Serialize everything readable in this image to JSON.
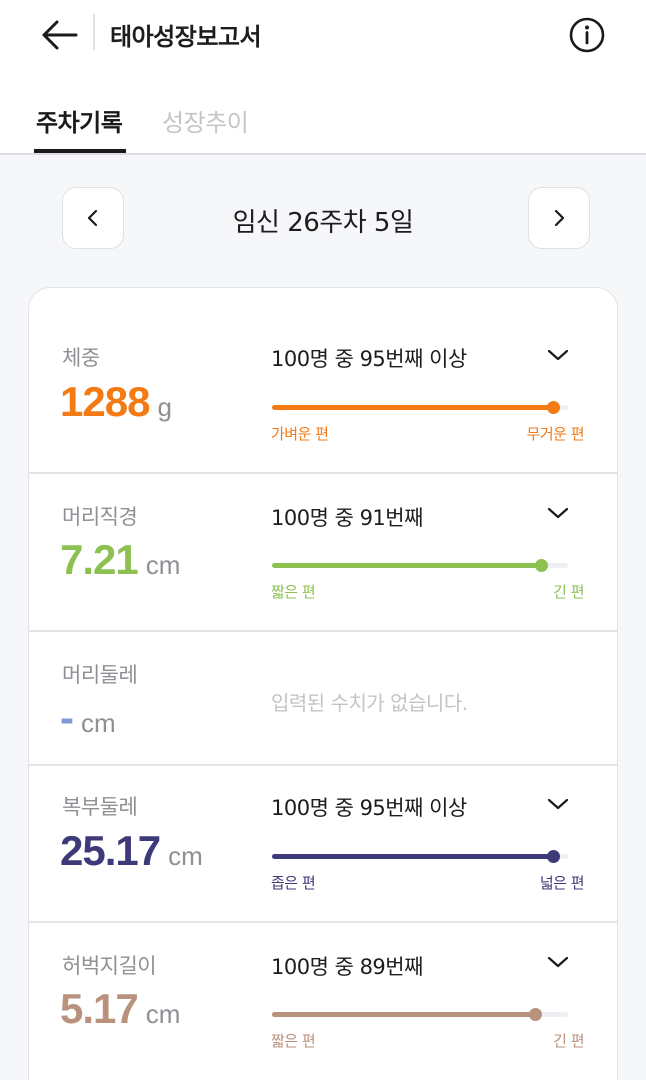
{
  "header": {
    "title": "태아성장보고서",
    "back_icon": "arrow-left-icon",
    "info_icon": "info-circle-icon"
  },
  "tabs": [
    {
      "label": "주차기록",
      "active": true
    },
    {
      "label": "성장추이",
      "active": false
    }
  ],
  "week_nav": {
    "label": "임신 26주차 5일",
    "prev_icon": "chevron-left-icon",
    "next_icon": "chevron-right-icon"
  },
  "metrics": [
    {
      "label": "체중",
      "value": "1288",
      "unit": "g",
      "rank": "100명 중 95번째 이상",
      "color": "#f47a14",
      "percentile": 0.95,
      "low_label": "가벼운 편",
      "high_label": "무거운 편"
    },
    {
      "label": "머리직경",
      "value": "7.21",
      "unit": "cm",
      "rank": "100명 중 91번째",
      "color": "#8cc152",
      "percentile": 0.91,
      "low_label": "짧은 편",
      "high_label": "긴 편"
    },
    {
      "label": "머리둘레",
      "value": "-",
      "unit": "cm",
      "empty_message": "입력된 수치가 없습니다.",
      "color": "#7f9ad6"
    },
    {
      "label": "복부둘레",
      "value": "25.17",
      "unit": "cm",
      "rank": "100명 중 95번째 이상",
      "color": "#3e3a7a",
      "percentile": 0.95,
      "low_label": "좁은 편",
      "high_label": "넓은 편"
    },
    {
      "label": "허벅지길이",
      "value": "5.17",
      "unit": "cm",
      "rank": "100명 중 89번째",
      "color": "#b8927c",
      "percentile": 0.89,
      "low_label": "짧은 편",
      "high_label": "긴 편"
    }
  ],
  "chevron_icon": "chevron-down-icon"
}
